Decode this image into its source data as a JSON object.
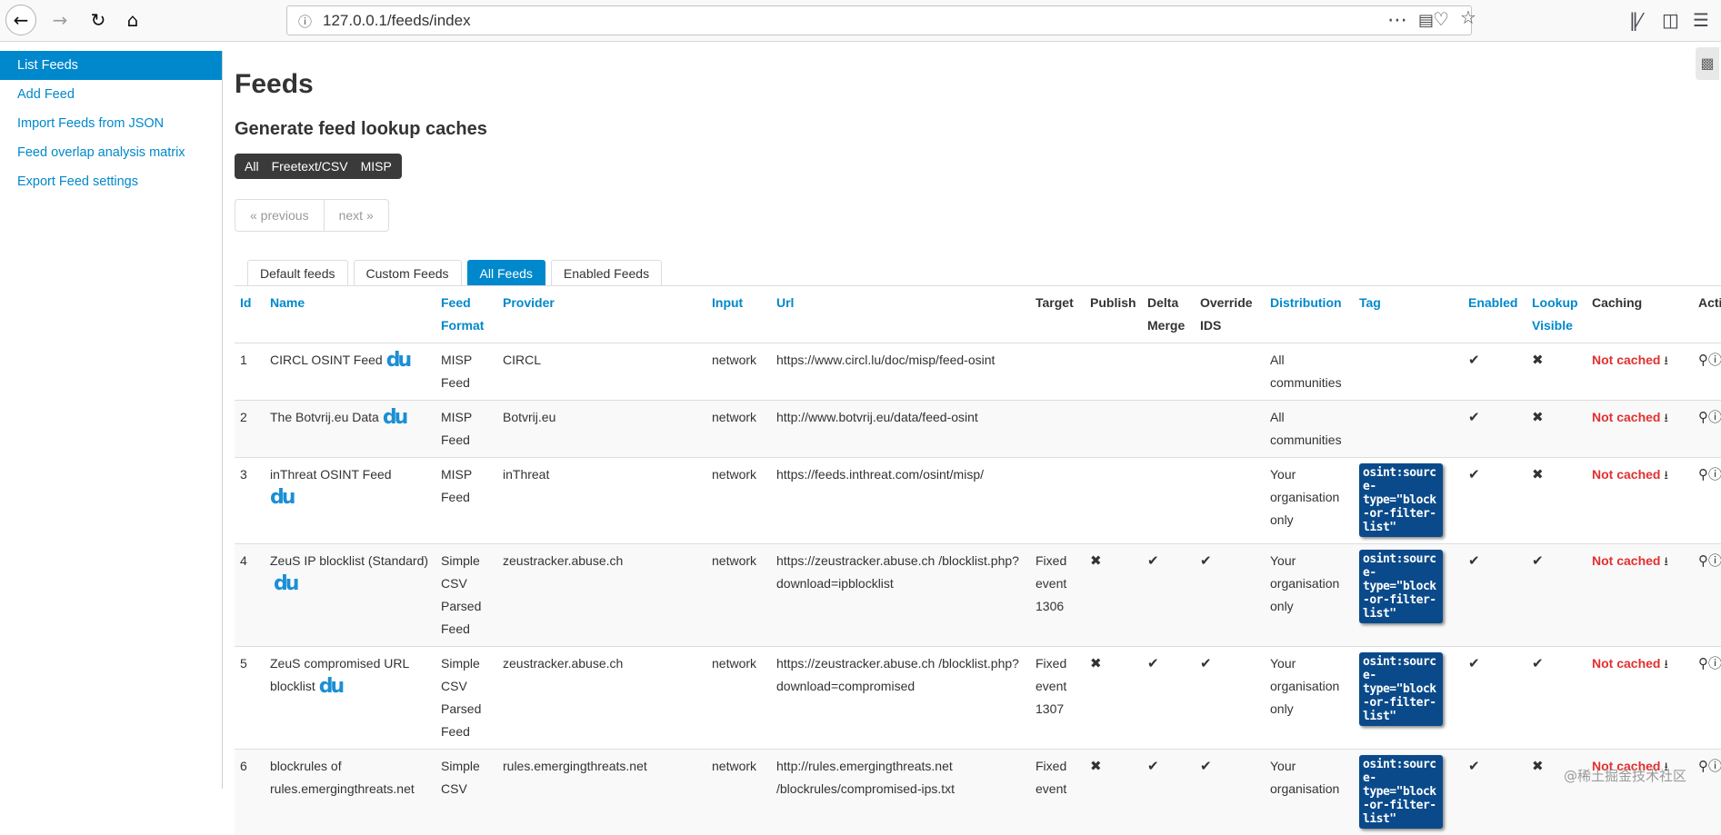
{
  "browser": {
    "url": "127.0.0.1/feeds/index"
  },
  "sidebar": {
    "items": [
      {
        "label": "List Feeds"
      },
      {
        "label": "Add Feed"
      },
      {
        "label": "Import Feeds from JSON"
      },
      {
        "label": "Feed overlap analysis matrix"
      },
      {
        "label": "Export Feed settings"
      }
    ]
  },
  "main": {
    "title": "Feeds",
    "subtitle": "Generate feed lookup caches",
    "cache_buttons": [
      "All",
      "Freetext/CSV",
      "MISP"
    ],
    "pager": {
      "previous": "« previous",
      "next": "next »"
    },
    "tabs": [
      "Default feeds",
      "Custom Feeds",
      "All Feeds",
      "Enabled Feeds"
    ],
    "active_tab": "All Feeds"
  },
  "table": {
    "headers": {
      "id": "Id",
      "name": "Name",
      "format": "Feed Format",
      "provider": "Provider",
      "input": "Input",
      "url": "Url",
      "target": "Target",
      "publish": "Publish",
      "delta": "Delta Merge",
      "override": "Override IDS",
      "distribution": "Distribution",
      "tag": "Tag",
      "enabled": "Enabled",
      "lookup": "Lookup Visible",
      "caching": "Caching",
      "actions": "Actions"
    },
    "rows": [
      {
        "id": "1",
        "name": "CIRCL OSINT Feed",
        "format": "MISP Feed",
        "provider": "CIRCL",
        "input": "network",
        "url": "https://www.circl.lu/doc/misp/feed-osint",
        "target": "",
        "publish": "",
        "delta": "",
        "override": "",
        "distribution": "All communities",
        "tag": "",
        "enabled": "✔",
        "lookup": "✖",
        "caching": "Not cached"
      },
      {
        "id": "2",
        "name": "The Botvrij.eu Data",
        "format": "MISP Feed",
        "provider": "Botvrij.eu",
        "input": "network",
        "url": "http://www.botvrij.eu/data/feed-osint",
        "target": "",
        "publish": "",
        "delta": "",
        "override": "",
        "distribution": "All communities",
        "tag": "",
        "enabled": "✔",
        "lookup": "✖",
        "caching": "Not cached"
      },
      {
        "id": "3",
        "name": "inThreat OSINT Feed",
        "format": "MISP Feed",
        "provider": "inThreat",
        "input": "network",
        "url": "https://feeds.inthreat.com/osint/misp/",
        "target": "",
        "publish": "",
        "delta": "",
        "override": "",
        "distribution": "Your organisation only",
        "tag": "osint:source-type=\"block-or-filter-list\"",
        "enabled": "✔",
        "lookup": "✖",
        "caching": "Not cached"
      },
      {
        "id": "4",
        "name": "ZeuS IP blocklist (Standard)",
        "format": "Simple CSV Parsed Feed",
        "provider": "zeustracker.abuse.ch",
        "input": "network",
        "url": "https://zeustracker.abuse.ch /blocklist.php?download=ipblocklist",
        "target": "Fixed event 1306",
        "publish": "✖",
        "delta": "✔",
        "override": "✔",
        "distribution": "Your organisation only",
        "tag": "osint:source-type=\"block-or-filter-list\"",
        "enabled": "✔",
        "lookup": "✔",
        "caching": "Not cached"
      },
      {
        "id": "5",
        "name": "ZeuS compromised URL blocklist",
        "format": "Simple CSV Parsed Feed",
        "provider": "zeustracker.abuse.ch",
        "input": "network",
        "url": "https://zeustracker.abuse.ch /blocklist.php?download=compromised",
        "target": "Fixed event 1307",
        "publish": "✖",
        "delta": "✔",
        "override": "✔",
        "distribution": "Your organisation only",
        "tag": "osint:source-type=\"block-or-filter-list\"",
        "enabled": "✔",
        "lookup": "✔",
        "caching": "Not cached"
      },
      {
        "id": "6",
        "name": "blockrules of rules.emergingthreats.net",
        "format": "Simple CSV",
        "provider": "rules.emergingthreats.net",
        "input": "network",
        "url": "http://rules.emergingthreats.net /blockrules/compromised-ips.txt",
        "target": "Fixed event",
        "publish": "✖",
        "delta": "✔",
        "override": "✔",
        "distribution": "Your organisation",
        "tag": "osint:source-type=\"block-or-filter-list\"",
        "enabled": "✔",
        "lookup": "✖",
        "caching": "Not cached"
      }
    ]
  },
  "watermark": "@稀土掘金技术社区",
  "colors": {
    "accent": "#0088cc",
    "danger": "#e23030",
    "tag_bg": "#0a4a8a"
  }
}
